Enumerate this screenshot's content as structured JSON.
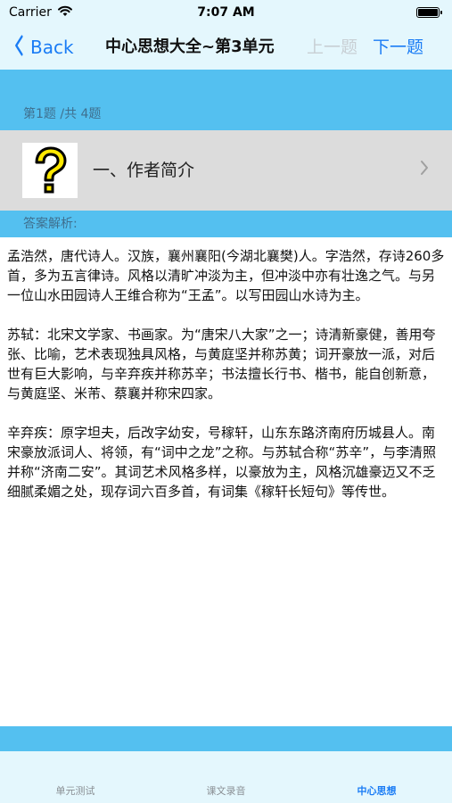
{
  "status_bar": {
    "carrier": "Carrier",
    "time": "7:07 AM"
  },
  "nav": {
    "back_label": "Back",
    "title": "中心思想大全~第3单元",
    "prev_label": "上一题",
    "next_label": "下一题"
  },
  "question": {
    "counter": "第1题 /共 4题",
    "title": "一、作者简介"
  },
  "answer": {
    "label": "答案解析:",
    "paragraphs": [
      "孟浩然，唐代诗人。汉族，襄州襄阳(今湖北襄樊)人。字浩然，存诗260多首，多为五言律诗。风格以清旷冲淡为主，但冲淡中亦有壮逸之气。与另一位山水田园诗人王维合称为“王孟”。以写田园山水诗为主。",
      "苏轼：北宋文学家、书画家。为“唐宋八大家”之一；诗清新豪健，善用夸张、比喻，艺术表现独具风格，与黄庭坚并称苏黄；词开豪放一派，对后世有巨大影响，与辛弃疾并称苏辛；书法擅长行书、楷书，能自创新意，与黄庭坚、米芾、蔡襄并称宋四家。",
      "辛弃疾：原字坦夫，后改字幼安，号稼轩，山东东路济南府历城县人。南宋豪放派词人、将领，有“词中之龙”之称。与苏轼合称“苏辛”，与李清照并称“济南二安”。其词艺术风格多样，以豪放为主，风格沉雄豪迈又不乏细腻柔媚之处，现存词六百多首，有词集《稼轩长短句》等传世。"
    ]
  },
  "tabs": [
    {
      "label": "单元测试"
    },
    {
      "label": "课文录音"
    },
    {
      "label": "中心思想"
    }
  ],
  "colors": {
    "accent": "#1a7cf5",
    "band": "#54c0f0",
    "bar_bg": "#e4f7fd",
    "row_bg": "#dcdcdc",
    "icon_yellow": "#ffe800"
  },
  "icons": {
    "question": "question-mark-icon",
    "wifi": "wifi-icon",
    "battery": "battery-icon",
    "back": "chevron-left-icon",
    "disclosure": "chevron-right-icon"
  }
}
